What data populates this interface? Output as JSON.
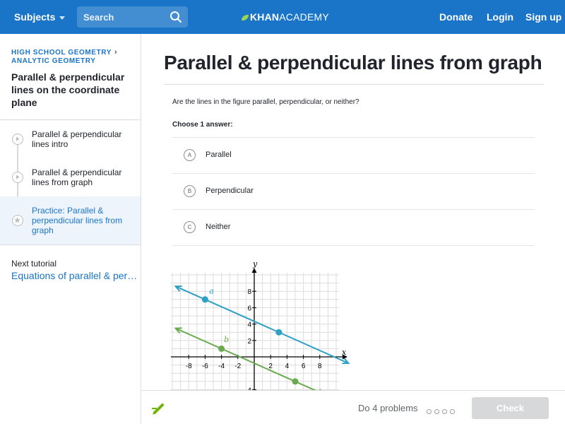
{
  "header": {
    "subjects_label": "Subjects",
    "search_placeholder": "Search",
    "logo_bold": "KHAN",
    "logo_light": "ACADEMY",
    "donate": "Donate",
    "login": "Login",
    "signup": "Sign up",
    "bar_color": "#1a74c8"
  },
  "sidebar": {
    "breadcrumb_1": "HIGH SCHOOL GEOMETRY",
    "breadcrumb_2": "ANALYTIC GEOMETRY",
    "title": "Parallel & perpendicular lines on the coordinate plane",
    "items": [
      {
        "label": "Parallel & perpendicular lines intro",
        "icon": "play-icon",
        "active": false
      },
      {
        "label": "Parallel & perpendicular lines from graph",
        "icon": "play-icon",
        "active": false
      },
      {
        "label": "Practice: Parallel & perpendicular lines from graph",
        "icon": "star-icon",
        "active": true
      }
    ],
    "next_label": "Next tutorial",
    "next_link": "Equations of parallel & per…"
  },
  "main": {
    "title": "Parallel & perpendicular lines from graph",
    "question": "Are the lines in the figure parallel, perpendicular, or neither?",
    "choose": "Choose 1 answer:",
    "options": [
      {
        "letter": "A",
        "label": "Parallel"
      },
      {
        "letter": "B",
        "label": "Perpendicular"
      },
      {
        "letter": "C",
        "label": "Neither"
      }
    ]
  },
  "graph": {
    "axis_x_label": "x",
    "axis_y_label": "y",
    "x_ticks": [
      "-8",
      "-6",
      "-4",
      "-2",
      "2",
      "4",
      "6",
      "8"
    ],
    "y_ticks": [
      "8",
      "6",
      "4",
      "2",
      "-4"
    ],
    "line_a": {
      "label": "a",
      "color": "#2ea0c4",
      "points": [
        [
          -6,
          7
        ],
        [
          3,
          3
        ]
      ]
    },
    "line_b": {
      "label": "b",
      "color": "#6aab4f",
      "points": [
        [
          -4,
          1
        ],
        [
          5,
          -3
        ]
      ]
    }
  },
  "footer": {
    "do_problems": "Do 4 problems",
    "check": "Check"
  }
}
